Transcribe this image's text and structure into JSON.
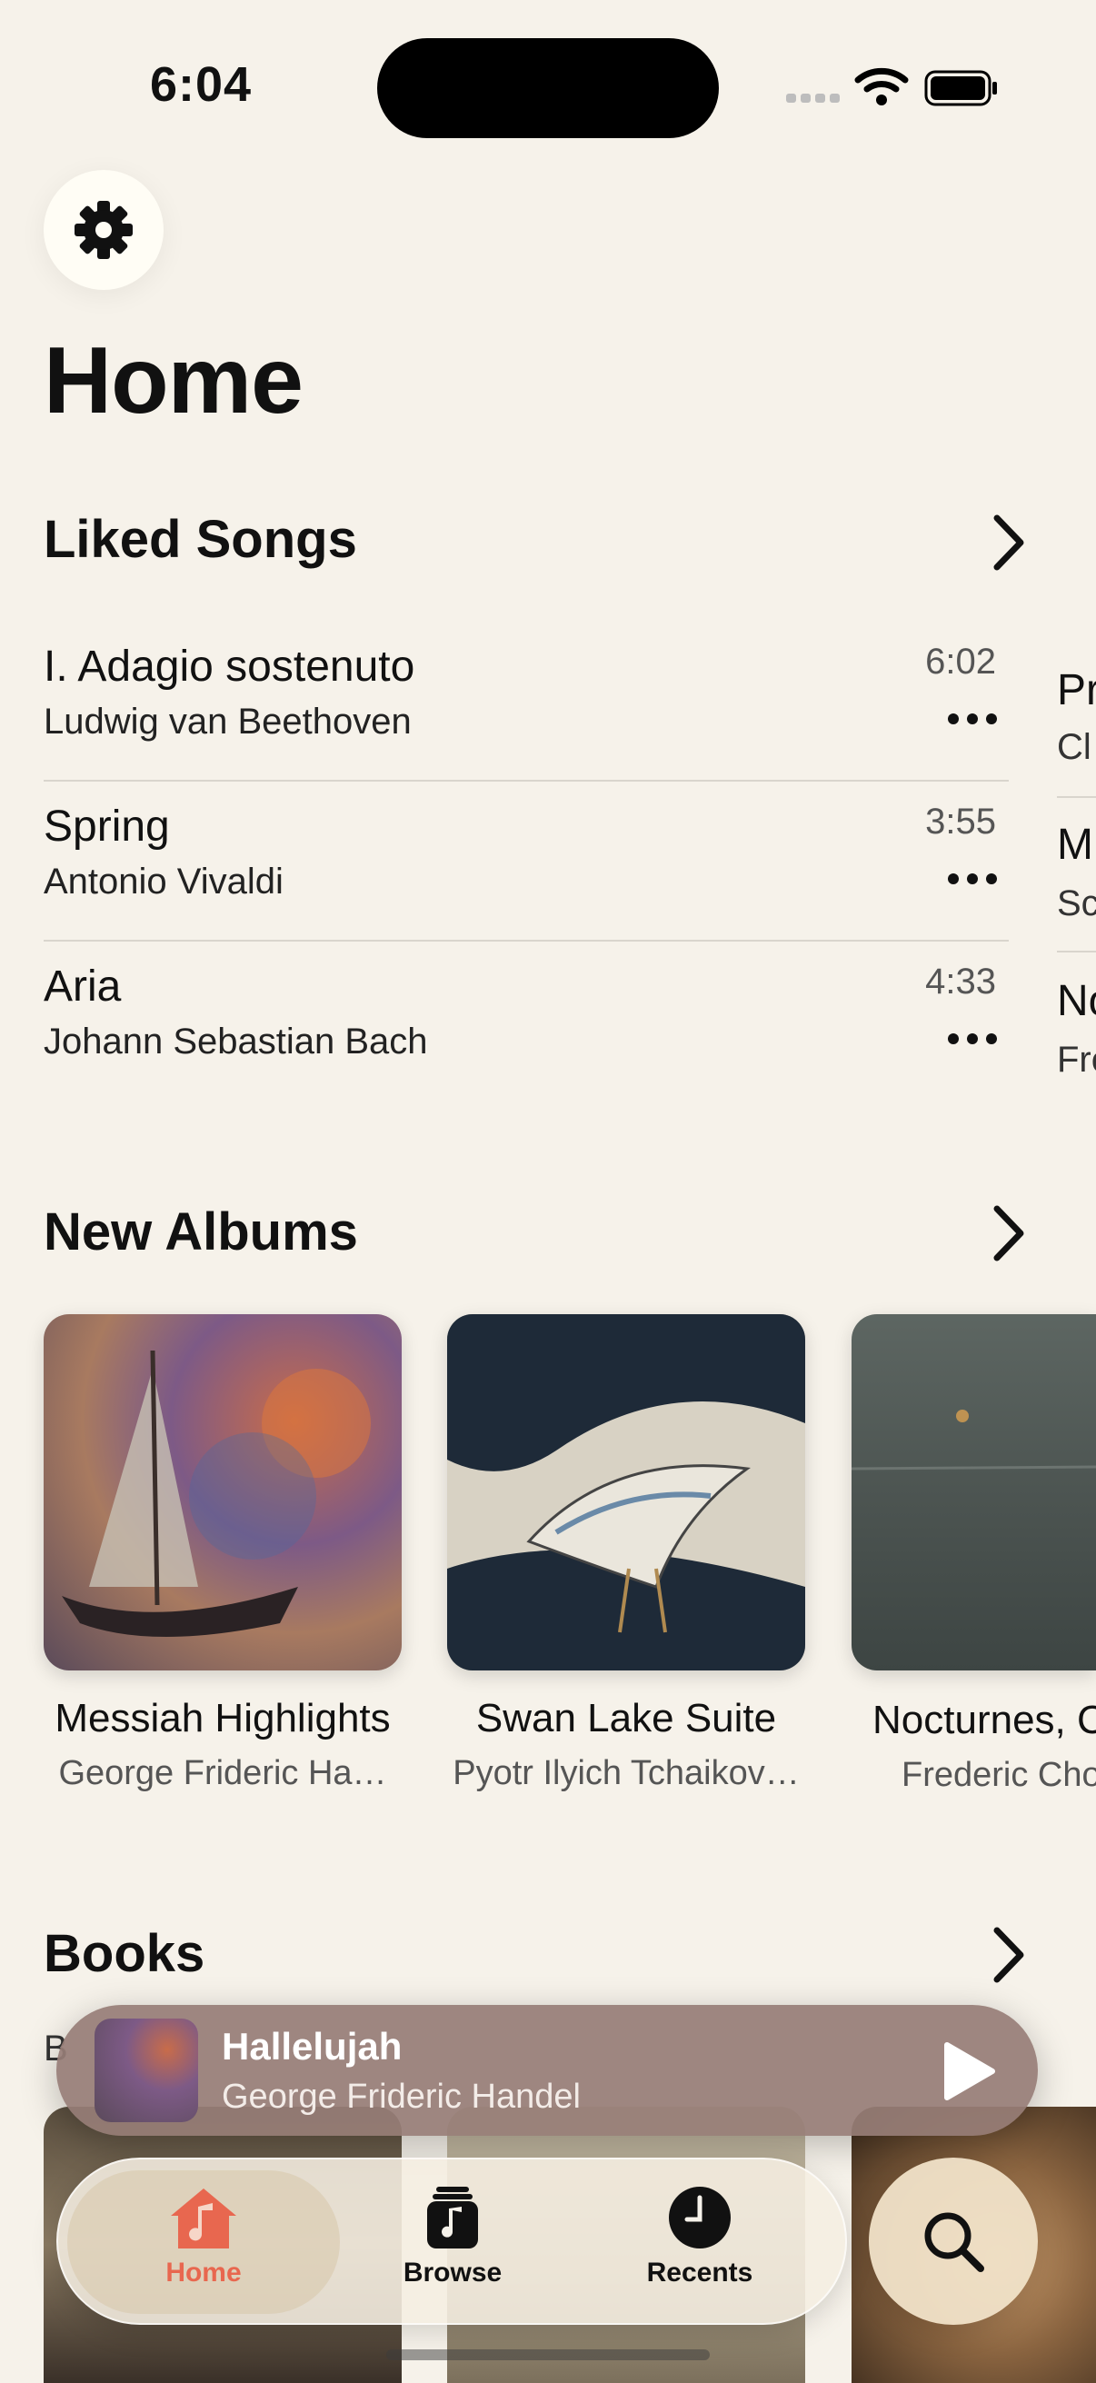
{
  "status": {
    "time": "6:04"
  },
  "page": {
    "title": "Home"
  },
  "liked_songs": {
    "title": "Liked Songs",
    "items": [
      {
        "title": "I. Adagio sostenuto",
        "artist": "Ludwig van Beethoven",
        "duration": "6:02"
      },
      {
        "title": "Spring",
        "artist": "Antonio Vivaldi",
        "duration": "3:55"
      },
      {
        "title": "Aria",
        "artist": "Johann Sebastian Bach",
        "duration": "4:33"
      }
    ],
    "peek": [
      {
        "title": "Pr",
        "artist": "Cl"
      },
      {
        "title": "M",
        "artist": "Sc"
      },
      {
        "title": "No",
        "artist": "Fre"
      }
    ]
  },
  "new_albums": {
    "title": "New Albums",
    "items": [
      {
        "title": "Messiah Highlights",
        "artist": "George Frideric Ha…"
      },
      {
        "title": "Swan Lake Suite",
        "artist": "Pyotr Ilyich Tchaikov…"
      },
      {
        "title": "Nocturnes, C",
        "artist": "Frederic Cho"
      }
    ]
  },
  "books": {
    "title": "Books",
    "peek_label": "B"
  },
  "now_playing": {
    "title": "Hallelujah",
    "artist": "George Frideric Handel"
  },
  "tabs": [
    {
      "label": "Home",
      "icon": "house-icon",
      "active": true
    },
    {
      "label": "Browse",
      "icon": "music-note-stack-icon",
      "active": false
    },
    {
      "label": "Recents",
      "icon": "clock-icon",
      "active": false
    }
  ],
  "colors": {
    "accent": "#e8674f",
    "background": "#f6f2ea",
    "mini_player": "#967d76"
  }
}
